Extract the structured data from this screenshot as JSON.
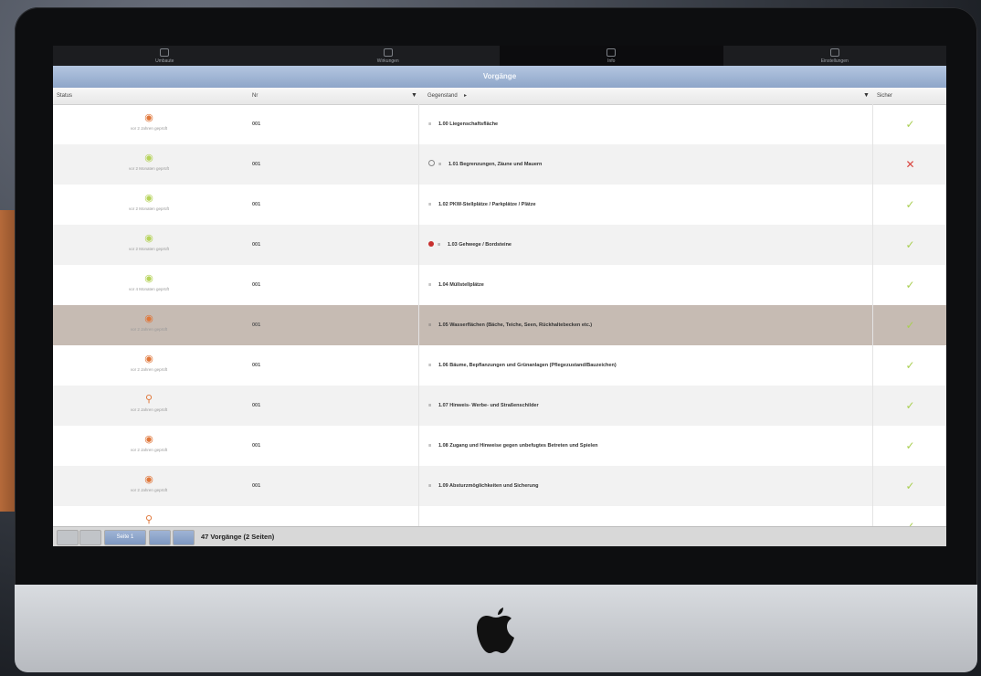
{
  "tabs": [
    {
      "label": "Umbaute",
      "active": false
    },
    {
      "label": "Wirkungen",
      "active": false
    },
    {
      "label": "Info",
      "active": true
    },
    {
      "label": "Einstellungen",
      "active": false
    }
  ],
  "title": "Vorgänge",
  "columns": {
    "status": "Status",
    "nr": "Nr",
    "subject": "Gegenstand",
    "check": "Sicher"
  },
  "rows": [
    {
      "eye": "orange",
      "status_sub": "vor 2 Jahren geprüft",
      "nr": "001",
      "mark": "",
      "subject": "1.00 Liegenschaftsfläche",
      "check": "ok"
    },
    {
      "eye": "green",
      "status_sub": "vor 2 Monaten geprüft",
      "nr": "001",
      "mark": "empty",
      "subject": "1.01 Begrenzungen, Zäune und Mauern",
      "check": "no"
    },
    {
      "eye": "green",
      "status_sub": "vor 2 Monaten geprüft",
      "nr": "001",
      "mark": "",
      "subject": "1.02 PKW-Stellplätze / Parkplätze / Plätze",
      "check": "ok"
    },
    {
      "eye": "green",
      "status_sub": "vor 2 Monaten geprüft",
      "nr": "001",
      "mark": "red",
      "subject": "1.03 Gehwege / Bordsteine",
      "check": "ok"
    },
    {
      "eye": "green",
      "status_sub": "vor 4 Monaten geprüft",
      "nr": "001",
      "mark": "",
      "subject": "1.04 Müllstellplätze",
      "check": "ok"
    },
    {
      "eye": "orange",
      "status_sub": "vor 2 Jahren geprüft",
      "nr": "001",
      "mark": "",
      "subject": "1.05 Wasserflächen (Bäche, Teiche, Seen, Rückhaltebecken etc.)",
      "check": "ok"
    },
    {
      "eye": "orange",
      "status_sub": "vor 2 Jahren geprüft",
      "nr": "001",
      "mark": "",
      "subject": "1.06 Bäume, Bepflanzungen und Grünanlagen (Pflegezustand/Bauzeichen)",
      "check": "ok"
    },
    {
      "eye": "search",
      "status_sub": "vor 2 Jahren geprüft",
      "nr": "001",
      "mark": "",
      "subject": "1.07 Hinweis- Werbe- und Straßenschilder",
      "check": "ok"
    },
    {
      "eye": "orange",
      "status_sub": "vor 2 Jahren geprüft",
      "nr": "001",
      "mark": "",
      "subject": "1.08 Zugang und Hinweise gegen unbefugtes Betreten und Spielen",
      "check": "ok"
    },
    {
      "eye": "orange",
      "status_sub": "vor 2 Jahren geprüft",
      "nr": "001",
      "mark": "",
      "subject": "1.09 Absturzmöglichkeiten und Sicherung",
      "check": "ok"
    },
    {
      "eye": "search",
      "status_sub": "",
      "nr": "",
      "mark": "",
      "subject": "",
      "check": "ok"
    }
  ],
  "selected_row": 5,
  "pager": {
    "page_label": "Seite 1",
    "count": "47 Vorgänge (2 Seiten)"
  }
}
